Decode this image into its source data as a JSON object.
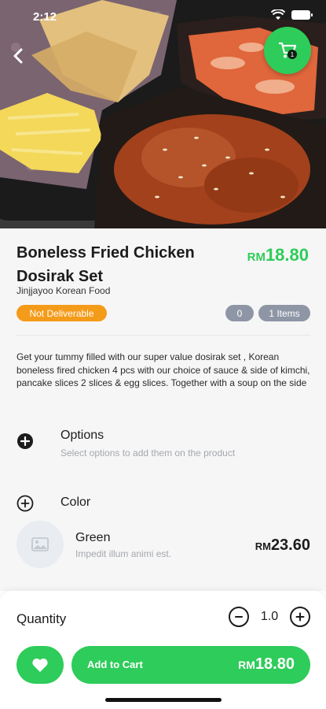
{
  "status_bar": {
    "time": "2:12"
  },
  "header": {
    "back_icon": "chevron-left-icon",
    "cart_icon": "shopping-cart-icon",
    "cart_badge": "1"
  },
  "product": {
    "title": "Boneless Fried Chicken Dosirak Set",
    "price_currency": "RM",
    "price_amount": "18.80",
    "vendor": "Jinjjayoo Korean Food",
    "delivery_status": "Not Deliverable",
    "count_badge": "0",
    "items_badge": "1 Items",
    "description": "Get your tummy filled with our super value dosirak set , Korean boneless fired chicken 4 pcs with our choice of sauce & side of kimchi, pancake slices 2 slices & egg slices. Together with a soup on the side"
  },
  "options": {
    "title": "Options",
    "subtitle": "Select options to add them on the product"
  },
  "color": {
    "title": "Color",
    "item_name": "Green",
    "item_description": "Impedit illum animi est.",
    "item_price_currency": "RM",
    "item_price_amount": "23.60"
  },
  "quantity": {
    "label": "Quantity",
    "value": "1.0"
  },
  "add_to_cart": {
    "label": "Add to Cart",
    "price_currency": "RM",
    "price_amount": "18.80"
  },
  "colors": {
    "accent": "#2ecc5a",
    "warning": "#f59b1a",
    "badge_gray": "#8e96a6"
  }
}
